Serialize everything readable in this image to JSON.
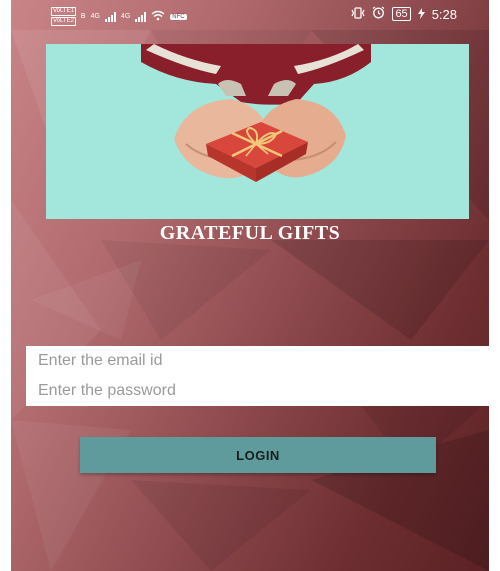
{
  "status_bar": {
    "sim_labels": [
      "VoLTE1",
      "VoLTE2"
    ],
    "sim_slots": [
      "B",
      "B"
    ],
    "network_left": "4G",
    "network_right": "4G",
    "data_badge": "NFC",
    "battery_level": "65",
    "time": "5:28"
  },
  "app": {
    "title": "GRATEFUL GIFTS"
  },
  "login_form": {
    "email_placeholder": "Enter the email id",
    "password_placeholder": "Enter the password",
    "login_label": "LOGIN"
  },
  "colors": {
    "background_light": "#c98488",
    "background_dark": "#5a2124",
    "hero_background": "#a3e6dc",
    "button": "#5f9b9c",
    "field_background": "#ffffff"
  }
}
